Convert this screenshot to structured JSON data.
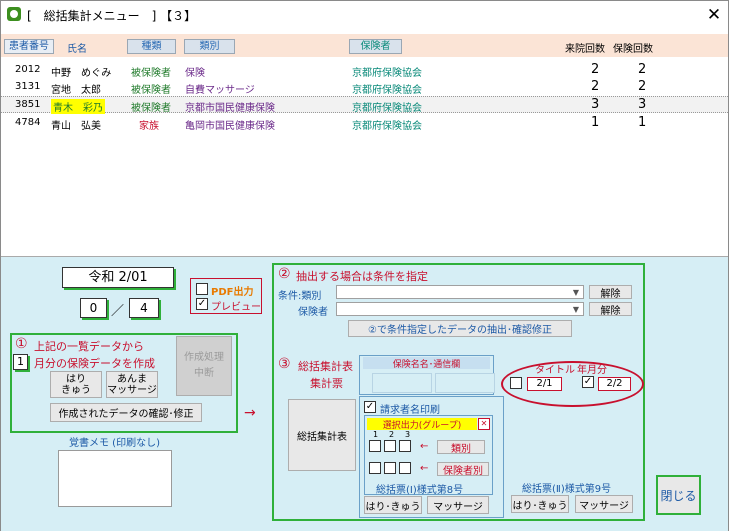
{
  "window": {
    "title": "[　総括集計メニュー　] 【３】",
    "close": "✕"
  },
  "header": {
    "col_patient_no": "患者番号",
    "col_name": "氏名",
    "col_type": "種類",
    "col_category": "類別",
    "col_insurer": "保険者",
    "col_visits": "来院回数",
    "col_insurance_count": "保険回数"
  },
  "rows": [
    {
      "no": "2012",
      "name": "中野　めぐみ",
      "type": "被保険者",
      "category": "保険",
      "insurer": "京都府保険協会",
      "visits": "2",
      "ins": "2"
    },
    {
      "no": "3131",
      "name": "宮地　太郎",
      "type": "被保険者",
      "category": "自費マッサージ",
      "insurer": "京都府保険協会",
      "visits": "2",
      "ins": "2"
    },
    {
      "no": "3851",
      "name": "青木　彩乃",
      "type": "被保険者",
      "category": "京都市国民健康保険",
      "insurer": "京都府保険協会",
      "visits": "3",
      "ins": "3"
    },
    {
      "no": "4784",
      "name": "青山　弘美",
      "type": "家族",
      "category": "亀岡市国民健康保険",
      "insurer": "京都府保険協会",
      "visits": "1",
      "ins": "1"
    }
  ],
  "left": {
    "era": "令和 2/01",
    "num_a": "0",
    "slash": "／",
    "num_b": "4",
    "sec1_num": "①",
    "sec1_title": "上記の一覧データから",
    "months": "1",
    "months_suffix": "月分の保険データを作成",
    "btn_hari": "はり\nきゅう",
    "btn_massage": "あんま\nマッサージ",
    "btn_stop": "作成処理\n中断",
    "btn_confirm": "作成されたデータの確認･修正",
    "memo_label": "覚書メモ (印刷なし)",
    "arrow": "→"
  },
  "pdf": {
    "pdf_label": "PDF出力",
    "preview_label": "プレビュー",
    "preview_check": "✓"
  },
  "right": {
    "sec2_num": "②",
    "sec2_title": "抽出する場合は条件を指定",
    "cond_label": "条件:類別",
    "insurer_label": "保険者",
    "clear1": "解除",
    "clear2": "解除",
    "extract_btn": "②で条件指定したデータの抽出･確認修正",
    "sec3_num": "③",
    "sec3_title": "総括集計表",
    "sec3_sub": "集計票",
    "insurer_name_label": "保険名名･通信欄",
    "title_label": "タイトル",
    "yearmonth_label": "年月分",
    "title_value": "2/1",
    "ym_value": "2/2",
    "ym_check": "✓",
    "summary_btn": "総括集計表",
    "req_print": "請求者名印刷",
    "req_check": "✓",
    "group_label": "選択出力(グループ)",
    "group_close": "✕",
    "g1": "1",
    "g2": "2",
    "g3": "3",
    "arrow": "←",
    "cat_btn": "類別",
    "ins_btn": "保険者別",
    "form1_label": "総括票(Ⅰ)様式第8号",
    "form2_label": "総括票(Ⅱ)様式第9号",
    "hari1": "はり･きゅう",
    "massage1": "マッサージ",
    "hari2": "はり･きゅう",
    "massage2": "マッサージ",
    "close_btn": "閉じる"
  },
  "colors": {
    "accent_green": "#2fb03a",
    "red": "#c8102e",
    "header_bg": "#fbe4d6",
    "panel_bg": "#d6eef5",
    "link_blue": "#1d5aa6",
    "teal": "#0a8a7a"
  }
}
